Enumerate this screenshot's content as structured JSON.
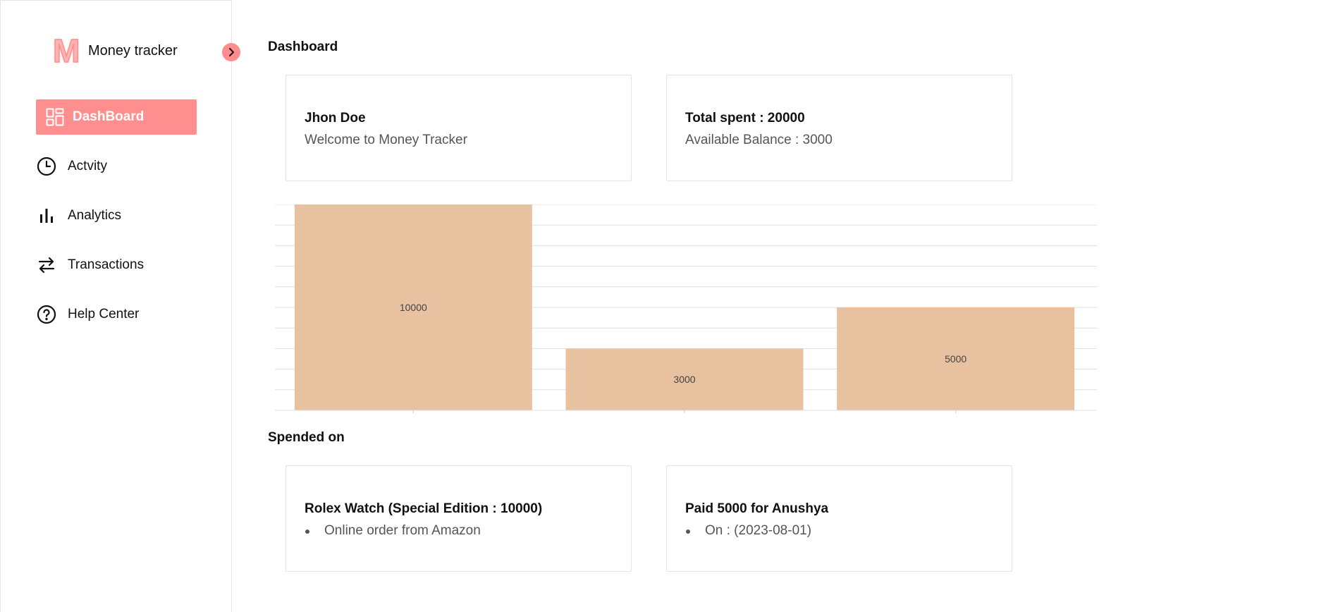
{
  "sidebar": {
    "brand_logo": "M",
    "brand_name": "Money tracker",
    "items": [
      {
        "label": "DashBoard",
        "icon": "grid-icon"
      },
      {
        "label": "Actvity",
        "icon": "clock-icon"
      },
      {
        "label": "Analytics",
        "icon": "bar-chart-icon"
      },
      {
        "label": "Transactions",
        "icon": "swap-arrows-icon"
      },
      {
        "label": "Help Center",
        "icon": "help-circle-icon"
      }
    ]
  },
  "main": {
    "dashboard_title": "Dashboard",
    "user_card": {
      "title": "Jhon Doe",
      "subtitle": "Welcome to Money Tracker"
    },
    "balance_card": {
      "title": "Total spent : 20000",
      "subtitle": "Available Balance : 3000"
    },
    "spended_title": "Spended on",
    "spend_items": [
      {
        "title": "Rolex Watch (Special Edition : 10000)",
        "detail": "Online order from Amazon"
      },
      {
        "title": "Paid 5000 for Anushya",
        "detail": "On : (2023-08-01)"
      }
    ]
  },
  "colors": {
    "accent": "#ff8f8f",
    "bar": "#e8c1a0",
    "grid": "#e0e0e0"
  },
  "chart_data": {
    "type": "bar",
    "categories": [
      "",
      "",
      ""
    ],
    "values": [
      10000,
      3000,
      5000
    ],
    "ylim": [
      0,
      10000
    ],
    "grid": true,
    "data_labels": [
      "10000",
      "3000",
      "5000"
    ]
  }
}
